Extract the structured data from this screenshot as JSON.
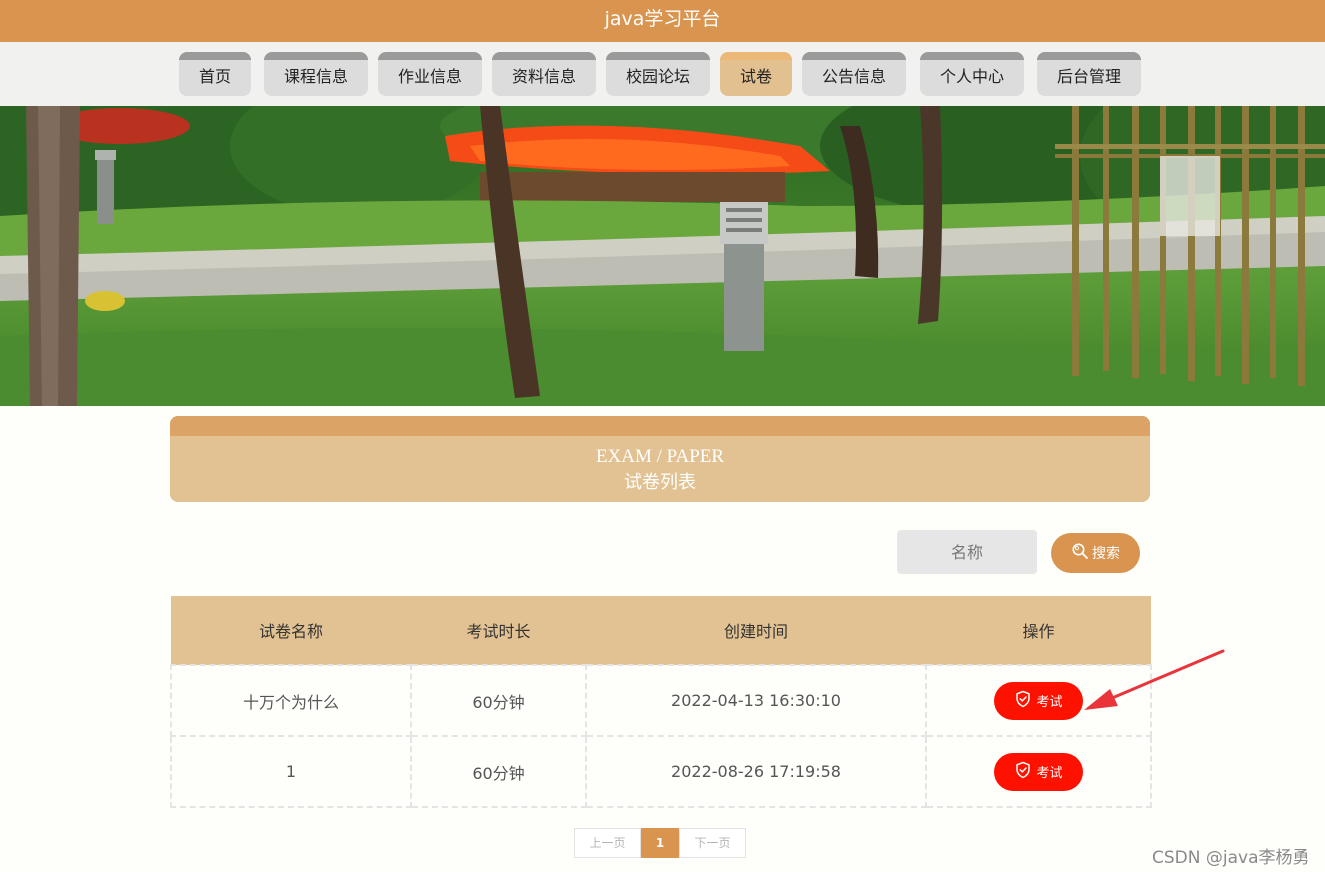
{
  "header": {
    "title": "java学习平台"
  },
  "nav": {
    "items": [
      {
        "label": "首页"
      },
      {
        "label": "课程信息"
      },
      {
        "label": "作业信息"
      },
      {
        "label": "资料信息"
      },
      {
        "label": "校园论坛"
      },
      {
        "label": "试卷",
        "active": true
      },
      {
        "label": "公告信息"
      },
      {
        "label": "个人中心"
      },
      {
        "label": "后台管理"
      }
    ]
  },
  "section": {
    "title_en": "EXAM / PAPER",
    "title_cn": "试卷列表"
  },
  "search": {
    "placeholder": "名称",
    "button_label": "搜索",
    "button_icon": "search-icon"
  },
  "table": {
    "headers": [
      "试卷名称",
      "考试时长",
      "创建时间",
      "操作"
    ],
    "rows": [
      {
        "name": "十万个为什么",
        "duration": "60分钟",
        "created": "2022-04-13 16:30:10",
        "action": "考试"
      },
      {
        "name": "1",
        "duration": "60分钟",
        "created": "2022-08-26 17:19:58",
        "action": "考试"
      }
    ]
  },
  "pagination": {
    "prev": "上一页",
    "current": "1",
    "next": "下一页"
  },
  "watermark": "CSDN @java李杨勇",
  "colors": {
    "brand": "#d99450",
    "tan": "#e2c292",
    "exam_button": "#ff1100",
    "annotation": "#e8343a"
  }
}
